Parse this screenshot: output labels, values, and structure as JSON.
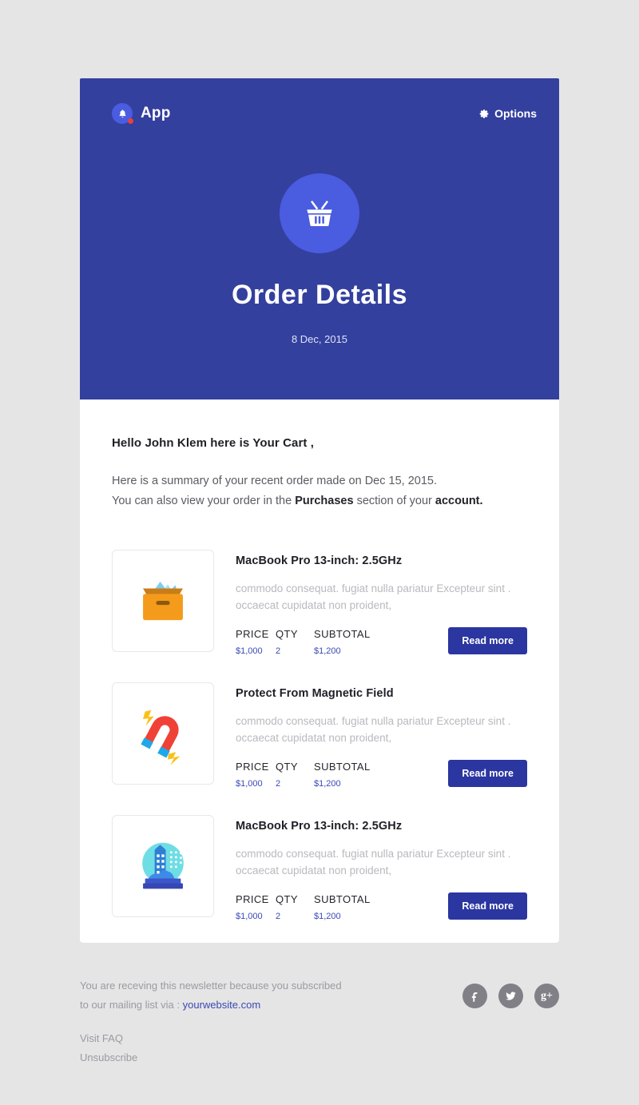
{
  "theme": {
    "page_bg": "#e5e5e5",
    "hero_bg": "#33409e",
    "accent": "#4a5ce0",
    "button_bg": "#2b36a0",
    "link": "#3a49b5",
    "notification_dot": "#e8413c",
    "social_bg": "#808086"
  },
  "header": {
    "brand_name": "App",
    "bell_icon": "bell-icon",
    "options_label": "Options",
    "gear_icon": "gear-icon"
  },
  "hero": {
    "basket_icon": "shopping-basket-icon",
    "title": "Order Details",
    "date": "8 Dec, 2015"
  },
  "body": {
    "greeting": "Hello John Klem here is Your Cart ,",
    "intro_line1": "Here is a summary of your recent order made on Dec 15, 2015.",
    "intro_line2_part1": "You can also view your order in the ",
    "intro_line2_bold1": "Purchases",
    "intro_line2_part2": " section of your ",
    "intro_line2_bold2": "account."
  },
  "table_headers": {
    "price": "PRICE",
    "qty": "QTY",
    "subtotal": "SUBTOTAL"
  },
  "products": [
    {
      "icon": "archive-box-icon",
      "title": "MacBook Pro 13-inch: 2.5GHz",
      "description_line1": "commodo consequat. fugiat nulla pariatur Excepteur sint .",
      "description_line2": "occaecat cupidatat non proident,",
      "price": "$1,000",
      "qty": "2",
      "subtotal": "$1,200",
      "button_label": "Read more"
    },
    {
      "icon": "magnet-icon",
      "title": "Protect From Magnetic Field",
      "description_line1": "commodo consequat. fugiat nulla pariatur Excepteur sint .",
      "description_line2": "occaecat cupidatat non proident,",
      "price": "$1,000",
      "qty": "2",
      "subtotal": "$1,200",
      "button_label": "Read more"
    },
    {
      "icon": "snow-globe-icon",
      "title": "MacBook Pro 13-inch: 2.5GHz",
      "description_line1": "commodo consequat. fugiat nulla pariatur Excepteur sint .",
      "description_line2": "occaecat cupidatat non proident,",
      "price": "$1,000",
      "qty": "2",
      "subtotal": "$1,200",
      "button_label": "Read more"
    }
  ],
  "footer": {
    "line1": "You are receving this newsletter because you subscribed",
    "line2_prefix": "to our mailing list via : ",
    "website_link": "yourwebsite.com",
    "faq_label": "Visit FAQ",
    "unsubscribe_label": "Unsubscribe",
    "socials": [
      {
        "name": "facebook-icon"
      },
      {
        "name": "twitter-icon"
      },
      {
        "name": "google-plus-icon"
      }
    ]
  }
}
